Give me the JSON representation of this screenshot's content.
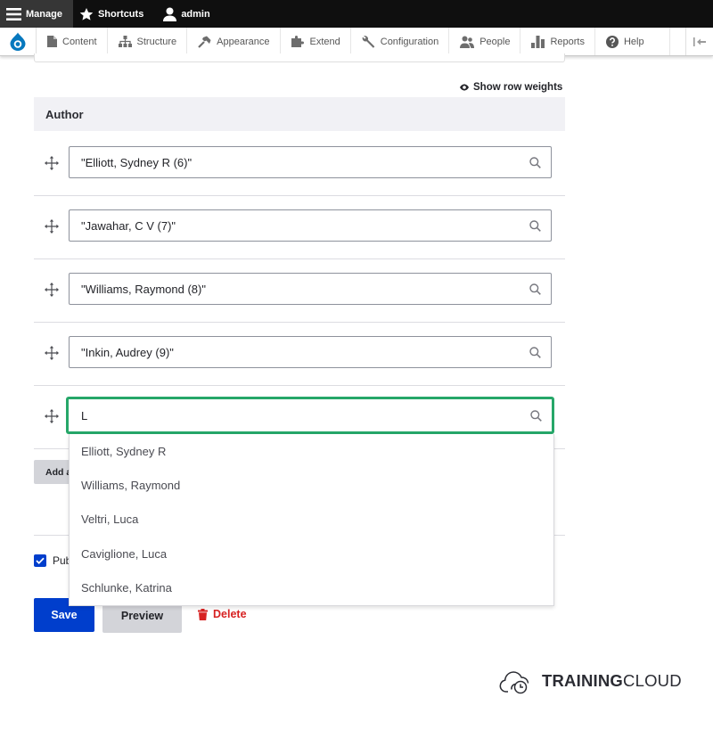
{
  "toolbar": {
    "manage": "Manage",
    "shortcuts": "Shortcuts",
    "user": "admin"
  },
  "tray": {
    "items": [
      {
        "label": "Content",
        "icon": "content-icon"
      },
      {
        "label": "Structure",
        "icon": "structure-icon"
      },
      {
        "label": "Appearance",
        "icon": "appearance-icon"
      },
      {
        "label": "Extend",
        "icon": "extend-icon"
      },
      {
        "label": "Configuration",
        "icon": "configuration-icon"
      },
      {
        "label": "People",
        "icon": "people-icon"
      },
      {
        "label": "Reports",
        "icon": "reports-icon"
      },
      {
        "label": "Help",
        "icon": "help-icon"
      }
    ]
  },
  "table": {
    "show_row_weights": "Show row weights",
    "header": "Author",
    "rows": [
      {
        "value": "\"Elliott, Sydney R (6)\""
      },
      {
        "value": "\"Jawahar, C V (7)\""
      },
      {
        "value": "\"Williams, Raymond (8)\""
      },
      {
        "value": "\"Inkin, Audrey (9)\""
      },
      {
        "value": "L"
      }
    ],
    "add_button_partial": "Add a"
  },
  "autocomplete": {
    "suggestions": [
      "Elliott, Sydney R",
      "Williams, Raymond",
      "Veltri, Luca",
      "Caviglione, Luca",
      "Schlunke, Katrina"
    ]
  },
  "publish": {
    "label_partial": "Pub",
    "checked": true
  },
  "actions": {
    "save": "Save",
    "preview": "Preview",
    "delete": "Delete"
  },
  "brand": {
    "bold": "TRAINING",
    "regular": "CLOUD"
  },
  "colors": {
    "primary": "#003ecc",
    "focus": "#26a769",
    "danger": "#d72222",
    "toolbar": "#0f0f0f"
  }
}
